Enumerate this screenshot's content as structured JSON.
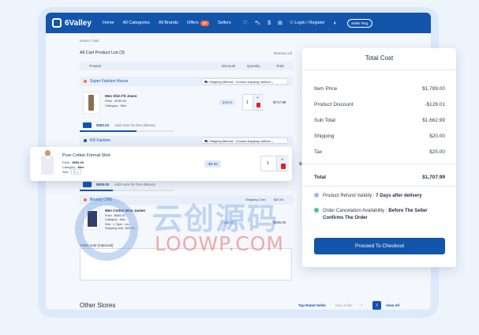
{
  "nav": {
    "brand": "6Valley",
    "links": [
      "Home",
      "All Categories",
      "All Brands",
      "Offers",
      "Sellers"
    ],
    "offers_badge": "30",
    "currency": "$",
    "login": "Login / Register",
    "seller_reg": "Seller Reg."
  },
  "breadcrumb": "Home / Cart",
  "cart": {
    "title": "All Cart Product List (3)",
    "remove_all": "Remove All",
    "headers": {
      "product": "Product",
      "discount": "Discount",
      "quantity": "Quantity",
      "total": "Total"
    },
    "shipping_label": "Shipping Method :",
    "shipping_placeholder": "Choose shipping method",
    "shop1": {
      "name": "Super Fashion House",
      "product": {
        "name": "Men Slim Fit Jeans",
        "price": "Price : $789.00",
        "category": "Category : Men",
        "discount": "-$78.91",
        "qty": "1",
        "total": "$717.99"
      },
      "free_amount": "$282.01",
      "free_text": "Add more for free delivery"
    },
    "shop2": {
      "name": "KR Fashion"
    },
    "popup_product": {
      "name": "Pure Cotton Formal Shirt",
      "price_label": "Price :",
      "price": "$500.00",
      "category_label": "Category :",
      "category": "Men",
      "size_label": "Size :",
      "size": "S",
      "discount": "-$5.00",
      "qty": "1",
      "total": "$495.00"
    },
    "shop2_free_amount": "$505.00",
    "shop2_free_text": "Add more for free delivery",
    "shop3": {
      "name": "Bounty CMS",
      "shipping_cost_label": "Shipping Cost :",
      "shipping_cost": "$20.00",
      "product": {
        "name": "Men Cotton Blue Jacket",
        "price": "Price : $565.00",
        "category": "Category : Men",
        "size": "Size : L",
        "type": "Type : Lev",
        "shipping": "Shipping cost : $20.00",
        "discount": "-$50.00",
        "total": "$536.00"
      }
    },
    "order_note": "Order note (Optional)"
  },
  "other_stores": {
    "title": "Other Stores",
    "tabs": [
      "Top Rated Seller",
      "New Seller"
    ],
    "view_all": "View All"
  },
  "total": {
    "title": "Total Cost",
    "rows": [
      {
        "label": "Item Price",
        "value": "$1,789.00"
      },
      {
        "label": "Product Discount",
        "value": "-$126.01"
      },
      {
        "label": "Sub Total",
        "value": "$1,662.99"
      },
      {
        "label": "Shipping",
        "value": "$20.00"
      },
      {
        "label": "Tax",
        "value": "$25.00"
      }
    ],
    "total_label": "Total",
    "total_value": "$1,707.99",
    "refund_label": "Product Refund Validity :",
    "refund_value": "7 Days after delivery",
    "cancel_label": "Order Cancelation Availability :",
    "cancel_value_1": "Before The Seller",
    "cancel_value_2": "Confirms The Order",
    "checkout": "Proceed To Checkout"
  },
  "watermark": {
    "big": "云创源码",
    "small": "LOOWP.COM"
  },
  "colors": {
    "primary": "#1455ac",
    "accent": "#ff6a3d",
    "danger": "#e02424"
  }
}
